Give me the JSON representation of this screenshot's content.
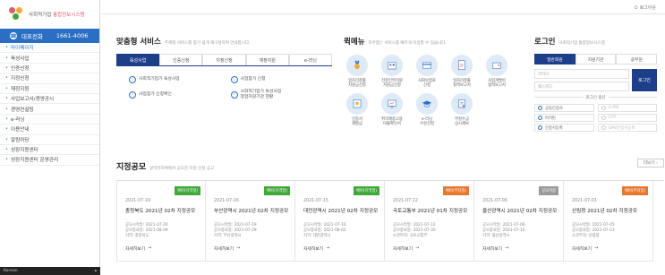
{
  "sidebar": {
    "logo_prefix": "사회적기업",
    "logo_highlight": "통합정보시스템",
    "phone_label": "대표전화",
    "phone_number": "1661-4006",
    "items": [
      {
        "label": "마이페이지",
        "active": true
      },
      {
        "label": "육성사업"
      },
      {
        "label": "인증신청"
      },
      {
        "label": "지정신청"
      },
      {
        "label": "재정지원"
      },
      {
        "label": "사업보고서/경영공시"
      },
      {
        "label": "경영컨설팅"
      },
      {
        "label": "e-러닝"
      },
      {
        "label": "이용안내"
      },
      {
        "label": "알림마당"
      },
      {
        "label": "성장지원센터"
      },
      {
        "label": "성장지원센터 운영관리"
      }
    ],
    "lang_label": "Korean"
  },
  "topbar": {
    "logout_label": "로그아웃"
  },
  "service": {
    "title": "맞춤형 서비스",
    "subtitle": "주제별 서비스를 찾기 쉽게 재구성하여 안내합니다.",
    "tabs": [
      "육성사업",
      "인증신청",
      "지정신청",
      "재정지원",
      "e-러닝"
    ],
    "items": [
      "사회적기업가 육성사업",
      "사업참가 신청",
      "사업참가 신청확인",
      "사회적기업가 육성사업\n창업지원기관 현황"
    ]
  },
  "quick": {
    "title": "퀵메뉴",
    "subtitle": "자주찾는 서비스를 빠르게 이용할 수 있습니다.",
    "items": [
      {
        "label": "일자리창출\n지원금신청",
        "icon": "medal-icon"
      },
      {
        "label": "전문인력지원\n지원금신청",
        "icon": "people-icon"
      },
      {
        "label": "사회보험료\n신청",
        "icon": "card-icon"
      },
      {
        "label": "일자리창출\n실적보고서",
        "icon": "document-icon"
      },
      {
        "label": "사업개발비\n실적보고서",
        "icon": "wallet-icon"
      },
      {
        "label": "인증서\n재발급",
        "icon": "certificate-icon"
      },
      {
        "label": "취약계층고용\n비율확인서",
        "icon": "monitor-icon"
      },
      {
        "label": "e-러닝\n수강신청",
        "icon": "graduation-icon"
      },
      {
        "label": "부정수급\n상시제보",
        "icon": "report-icon"
      }
    ]
  },
  "login": {
    "title": "로그인",
    "subtitle": "사회적기업 통합정보시스템",
    "tabs": [
      "일반회원",
      "지원기관",
      "공무원"
    ],
    "id_placeholder": "아이디",
    "pw_placeholder": "패스워드",
    "button_label": "로그인",
    "options_title": "로그인 옵션",
    "options": [
      {
        "label": "공동인증서",
        "enabled": true
      },
      {
        "label": "G-PIN",
        "enabled": false
      },
      {
        "label": "아이핀",
        "enabled": true
      },
      {
        "label": "OTP",
        "enabled": false
      },
      {
        "label": "인증서등록",
        "enabled": true
      },
      {
        "label": "GPKI인증서등록",
        "enabled": false
      }
    ]
  },
  "notices": {
    "title": "지정공모",
    "subtitle": "광역지자체에서 공모한 지정 신청 공고",
    "more_label": "더보기",
    "cards": [
      {
        "badge": "예비(지역형)",
        "color": "green",
        "date": "2021-07-19",
        "title": "충청북도 2021년 02차 지정공모",
        "start": "공모시작일: 2021-07-20",
        "end": "공모종료일: 2021-08-09",
        "region": "지역: 충청북도",
        "link": "자세히보기"
      },
      {
        "badge": "예비(지역형)",
        "color": "green",
        "date": "2021-07-16",
        "title": "부산광역시 2021년 02차 지정공모",
        "start": "공모시작일: 2021-07-19",
        "end": "공모종료일: 2021-07-29",
        "region": "지역: 부산광역시",
        "link": "자세히보기"
      },
      {
        "badge": "예비(지역형)",
        "color": "green",
        "date": "2021-07-15",
        "title": "대전광역시 2021년 02차 지정공모",
        "start": "공모시작일: 2021-07-16",
        "end": "공모종료일: 2021-08-02",
        "region": "지역: 대전광역시",
        "link": "자세히보기"
      },
      {
        "badge": "예비(부처형)",
        "color": "orange",
        "date": "2021-07-12",
        "title": "국토교통부 2021년 01차 지정공모",
        "start": "공모시작일: 2021-07-12",
        "end": "공모종료일: 2021-07-30",
        "region": "소관부처: 국토교통부",
        "link": "자세히보기"
      },
      {
        "badge": "공모마감",
        "color": "gray",
        "date": "2021-07-06",
        "title": "울산광역시 2021년 02차 지정공모",
        "start": "공모시작일: 2021-07-06",
        "end": "공모종료일: 2021-07-16",
        "region": "지역: 울산광역시",
        "link": "자세히보기"
      },
      {
        "badge": "예비(부처형)",
        "color": "orange",
        "date": "2021-07-01",
        "title": "산림청 2021년 02차 지정공모",
        "start": "공모시작일: 2021-07-05",
        "end": "공모종료일: 2021-07-23",
        "region": "소관부처: 산림청",
        "link": "자세히보기"
      }
    ]
  }
}
